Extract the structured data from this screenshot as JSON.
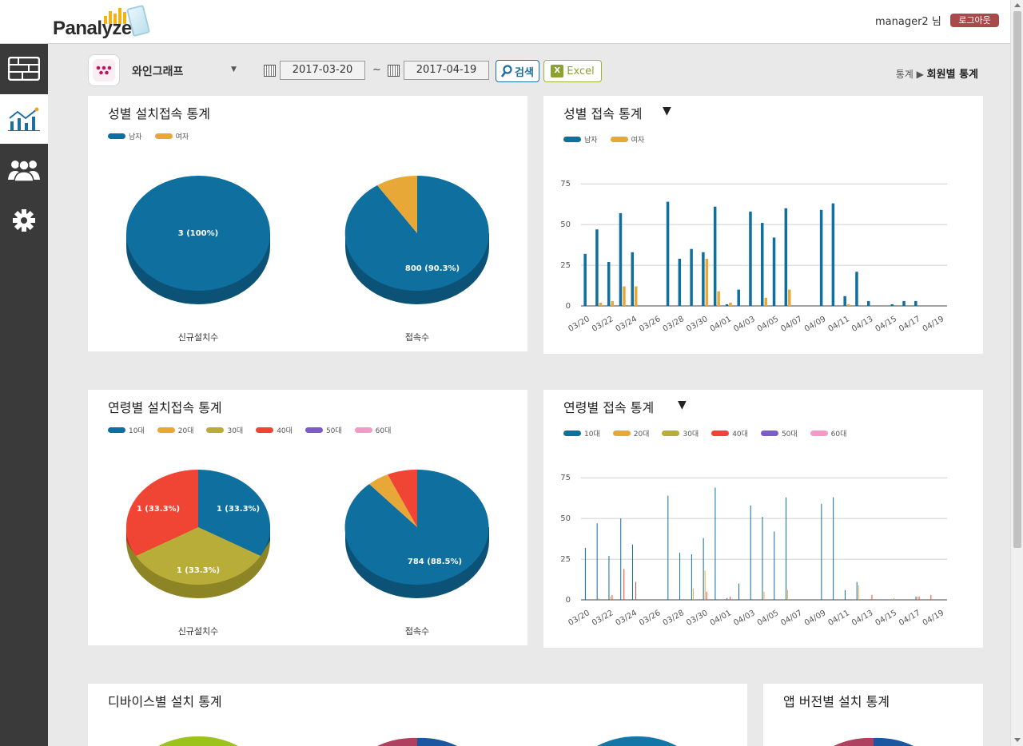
{
  "header": {
    "logo_text": "Panalyzer",
    "user_name": "manager2 님",
    "logout_label": "로그아웃"
  },
  "toolbar": {
    "app_name": "와인그래프",
    "start_date": "2017-03-20",
    "separator": "~",
    "end_date": "2017-04-19",
    "search_label": "검색",
    "excel_label": "Excel"
  },
  "breadcrumb": {
    "parent": "통계",
    "arrow": "▶",
    "current": "회원별 통계"
  },
  "sidebar": {
    "items": [
      {
        "icon": "dashboard-icon",
        "active": false
      },
      {
        "icon": "chart-line-icon",
        "active": true
      },
      {
        "icon": "users-icon",
        "active": false
      },
      {
        "icon": "gear-icon",
        "active": false
      }
    ]
  },
  "colors": {
    "male": "#0f6f9f",
    "female": "#e8a838",
    "age10": "#0f6f9f",
    "age20": "#e8a838",
    "age30": "#b9ad3a",
    "age40": "#f04535",
    "age50": "#7d5bc8",
    "age60": "#f49ac8"
  },
  "gender_legend": [
    "남자",
    "여자"
  ],
  "age_legend": [
    "10대",
    "20대",
    "30대",
    "40대",
    "50대",
    "60대"
  ],
  "cards": {
    "gender_install": {
      "title": "성별 설치접속 통계",
      "pie1_caption": "신규설치수",
      "pie2_caption": "접속수",
      "pie1_label": "3 (100%)",
      "pie2_label": "800 (90.3%)"
    },
    "gender_access": {
      "title": "성별 접속 통계",
      "caret": "▼"
    },
    "age_install": {
      "title": "연령별 설치접속 통계",
      "pie1_caption": "신규설치수",
      "pie2_caption": "접속수",
      "pie1_labels": [
        "1 (33.3%)",
        "1 (33.3%)",
        "1 (33.3%)"
      ],
      "pie2_label": "784 (88.5%)"
    },
    "age_access": {
      "title": "연령별 접속 통계",
      "caret": "▼"
    },
    "device_install": {
      "title": "디바이스별 설치 통계"
    },
    "version_install": {
      "title": "앱 버전별 설치 통계"
    }
  },
  "chart_data": [
    {
      "type": "pie",
      "name": "gender-install-new",
      "categories": [
        "남자",
        "여자"
      ],
      "values": [
        3,
        0
      ],
      "label": "3 (100%)"
    },
    {
      "type": "pie",
      "name": "gender-install-access",
      "categories": [
        "남자",
        "여자"
      ],
      "values": [
        800,
        86
      ],
      "label": "800 (90.3%)"
    },
    {
      "type": "bar",
      "name": "gender-access",
      "categories": [
        "03/20",
        "03/21",
        "03/22",
        "03/23",
        "03/24",
        "03/25",
        "03/26",
        "03/27",
        "03/28",
        "03/29",
        "03/30",
        "03/31",
        "04/01",
        "04/02",
        "04/03",
        "04/04",
        "04/05",
        "04/06",
        "04/07",
        "04/08",
        "04/09",
        "04/10",
        "04/11",
        "04/12",
        "04/13",
        "04/14",
        "04/15",
        "04/16",
        "04/17",
        "04/18",
        "04/19"
      ],
      "tick_labels": [
        "03/20",
        "03/22",
        "03/24",
        "03/26",
        "03/28",
        "03/30",
        "04/01",
        "04/03",
        "04/05",
        "04/07",
        "04/09",
        "04/11",
        "04/13",
        "04/15",
        "04/17",
        "04/19"
      ],
      "series": [
        {
          "name": "남자",
          "values": [
            32,
            47,
            27,
            57,
            33,
            0,
            0,
            64,
            29,
            35,
            33,
            61,
            1,
            10,
            58,
            51,
            42,
            60,
            0,
            0,
            59,
            63,
            6,
            21,
            3,
            0,
            1,
            3,
            3,
            0,
            0
          ]
        },
        {
          "name": "여자",
          "values": [
            0,
            2,
            3,
            12,
            12,
            0,
            0,
            0,
            0,
            0,
            29,
            9,
            2,
            0,
            0,
            5,
            0,
            10,
            0,
            0,
            0,
            0,
            1,
            0,
            0,
            0,
            0,
            0,
            0,
            0,
            0
          ]
        }
      ],
      "yticks": [
        0,
        25,
        50,
        75
      ],
      "ylim": [
        0,
        80
      ]
    },
    {
      "type": "pie",
      "name": "age-install-new",
      "categories": [
        "10대",
        "30대",
        "40대"
      ],
      "values": [
        1,
        1,
        1
      ],
      "labels": [
        "1 (33.3%)",
        "1 (33.3%)",
        "1 (33.3%)"
      ]
    },
    {
      "type": "pie",
      "name": "age-install-access",
      "categories": [
        "10대",
        "20대",
        "40대"
      ],
      "values": [
        784,
        46,
        55
      ],
      "label": "784 (88.5%)"
    },
    {
      "type": "bar",
      "name": "age-access",
      "categories": [
        "03/20",
        "03/21",
        "03/22",
        "03/23",
        "03/24",
        "03/25",
        "03/26",
        "03/27",
        "03/28",
        "03/29",
        "03/30",
        "03/31",
        "04/01",
        "04/02",
        "04/03",
        "04/04",
        "04/05",
        "04/06",
        "04/07",
        "04/08",
        "04/09",
        "04/10",
        "04/11",
        "04/12",
        "04/13",
        "04/14",
        "04/15",
        "04/16",
        "04/17",
        "04/18",
        "04/19"
      ],
      "tick_labels": [
        "03/20",
        "03/22",
        "03/24",
        "03/26",
        "03/28",
        "03/30",
        "04/01",
        "04/03",
        "04/05",
        "04/07",
        "04/09",
        "04/11",
        "04/13",
        "04/15",
        "04/17",
        "04/19"
      ],
      "series": [
        {
          "name": "10대",
          "values": [
            32,
            47,
            27,
            50,
            34,
            0,
            0,
            64,
            29,
            28,
            38,
            69,
            1,
            10,
            58,
            51,
            42,
            63,
            0,
            0,
            59,
            63,
            6,
            11,
            0,
            0,
            0,
            0,
            2,
            0,
            0
          ]
        },
        {
          "name": "20대",
          "values": [
            0,
            1,
            2,
            0,
            0,
            0,
            0,
            0,
            0,
            7,
            18,
            0,
            0,
            0,
            0,
            5,
            0,
            6,
            0,
            0,
            0,
            0,
            0,
            9,
            0,
            0,
            1,
            0,
            2,
            0,
            0
          ]
        },
        {
          "name": "40대",
          "values": [
            0,
            0,
            3,
            19,
            11,
            0,
            0,
            0,
            0,
            0,
            5,
            0,
            2,
            0,
            0,
            0,
            0,
            0,
            0,
            0,
            0,
            0,
            0,
            0,
            3,
            0,
            0,
            0,
            2,
            3,
            0
          ]
        }
      ],
      "yticks": [
        0,
        25,
        50,
        75
      ],
      "ylim": [
        0,
        80
      ]
    }
  ]
}
